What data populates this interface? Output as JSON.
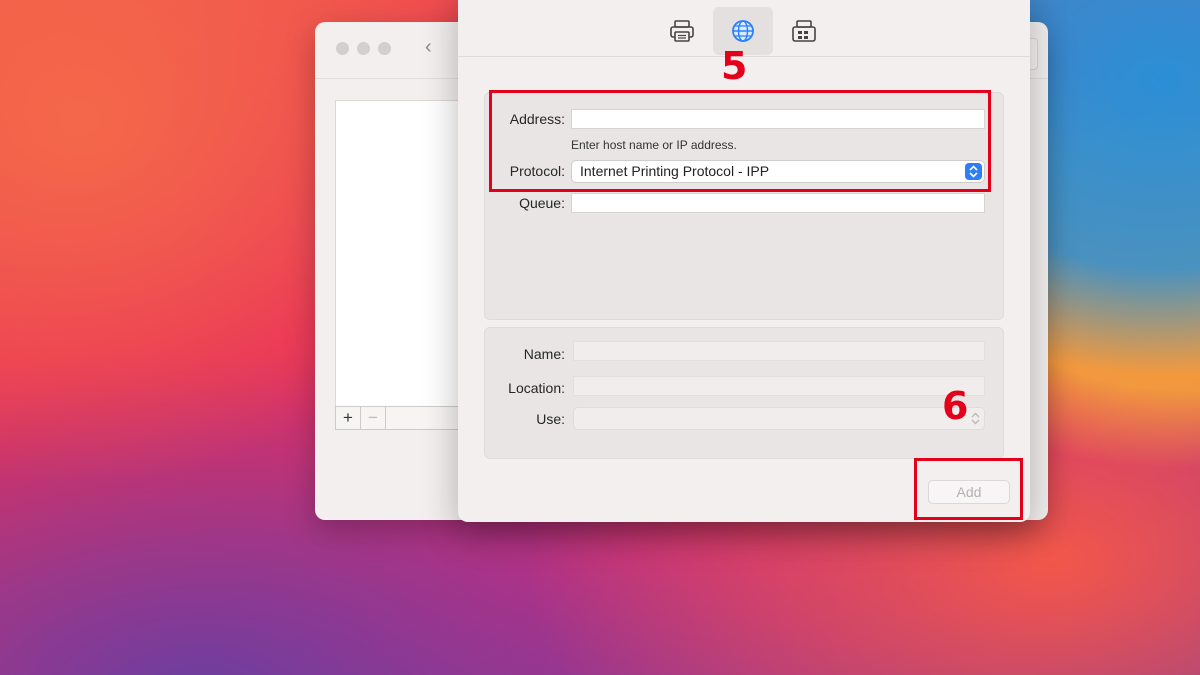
{
  "back_window": {
    "buttons": {
      "add": "+",
      "remove": "−"
    }
  },
  "sheet": {
    "tabs": [
      {
        "icon": "printer-icon",
        "active": false
      },
      {
        "icon": "globe-icon",
        "active": true
      },
      {
        "icon": "fax-printer-icon",
        "active": false
      }
    ],
    "address": {
      "label": "Address:",
      "value": "",
      "hint": "Enter host name or IP address."
    },
    "protocol": {
      "label": "Protocol:",
      "value": "Internet Printing Protocol - IPP"
    },
    "queue": {
      "label": "Queue:",
      "value": ""
    },
    "name": {
      "label": "Name:",
      "value": ""
    },
    "location": {
      "label": "Location:",
      "value": ""
    },
    "use": {
      "label": "Use:",
      "value": ""
    },
    "add_button": "Add"
  },
  "annotations": {
    "step5": "5",
    "step6": "6",
    "highlight_color": "#e3001b"
  },
  "colors": {
    "accent": "#2d7ff9"
  }
}
